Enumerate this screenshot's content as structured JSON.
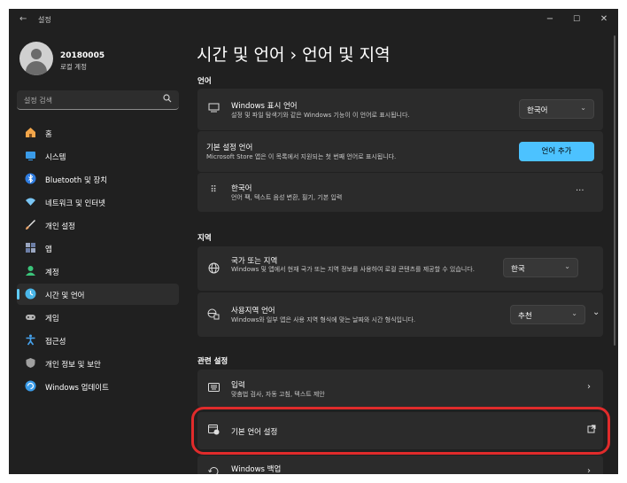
{
  "window": {
    "back_glyph": "←",
    "title": "설정",
    "minimize": "−",
    "maximize": "☐",
    "close": "✕"
  },
  "profile": {
    "name": "20180005",
    "account": "로컬 계정"
  },
  "search": {
    "placeholder": "설정 검색",
    "icon": "search-icon"
  },
  "sidebar": {
    "items": [
      {
        "label": "홈",
        "icon": "home-icon",
        "color": "#f3a64a"
      },
      {
        "label": "시스템",
        "icon": "system-icon",
        "color": "#3a9be8"
      },
      {
        "label": "Bluetooth 및 장치",
        "icon": "bluetooth-icon",
        "color": "#2f7de1"
      },
      {
        "label": "네트워크 및 인터넷",
        "icon": "network-icon",
        "color": "#7ac6f5"
      },
      {
        "label": "개인 설정",
        "icon": "brush-icon",
        "color": "#e8a36a"
      },
      {
        "label": "앱",
        "icon": "apps-icon",
        "color": "#9aa6c0"
      },
      {
        "label": "계정",
        "icon": "account-icon",
        "color": "#3bc47a"
      },
      {
        "label": "시간 및 언어",
        "icon": "time-language-icon",
        "color": "#4ab6e8",
        "active": true
      },
      {
        "label": "게임",
        "icon": "gaming-icon",
        "color": "#b4b4b4"
      },
      {
        "label": "접근성",
        "icon": "accessibility-icon",
        "color": "#46a4f0"
      },
      {
        "label": "개인 정보 및 보안",
        "icon": "shield-icon",
        "color": "#a0a0a0"
      },
      {
        "label": "Windows 업데이트",
        "icon": "update-icon",
        "color": "#3a9be8"
      }
    ]
  },
  "main": {
    "title": "시간 및 언어  ›  언어 및 지역",
    "language_section": "언어",
    "display_language": {
      "title": "Windows 표시 언어",
      "desc": "설정 및 파일 탐색기와 같은 Windows 기능이 이 언어로 표시됩니다.",
      "value": "한국어"
    },
    "preferred_languages": {
      "title": "기본 설정 언어",
      "desc": "Microsoft Store 앱은 이 목록에서 지원되는 첫 번째 언어로 표시됩니다.",
      "button": "언어 추가"
    },
    "korean_language": {
      "title": "한국어",
      "desc": "언어 팩, 텍스트 음성 변환, 필기, 기본 입력",
      "more": "···"
    },
    "region_section": "지역",
    "country": {
      "title": "국가 또는 지역",
      "desc": "Windows 및 앱에서 현재 국가 또는 지역 정보를 사용하여 로컬 콘텐츠를 제공할 수 있습니다.",
      "value": "한국"
    },
    "regional_format": {
      "title": "사용지역 언어",
      "desc": "Windows와 일부 앱은 사용 지역 형식에 맞는 날짜와 시간 형식입니다.",
      "value": "추천"
    },
    "related_section": "관련 설정",
    "typing": {
      "title": "입력",
      "desc": "맞춤법 검사, 자동 고침, 텍스트 제안"
    },
    "admin_language": {
      "title": "기본 언어 설정"
    },
    "windows_backup": {
      "title": "Windows 백업"
    }
  }
}
